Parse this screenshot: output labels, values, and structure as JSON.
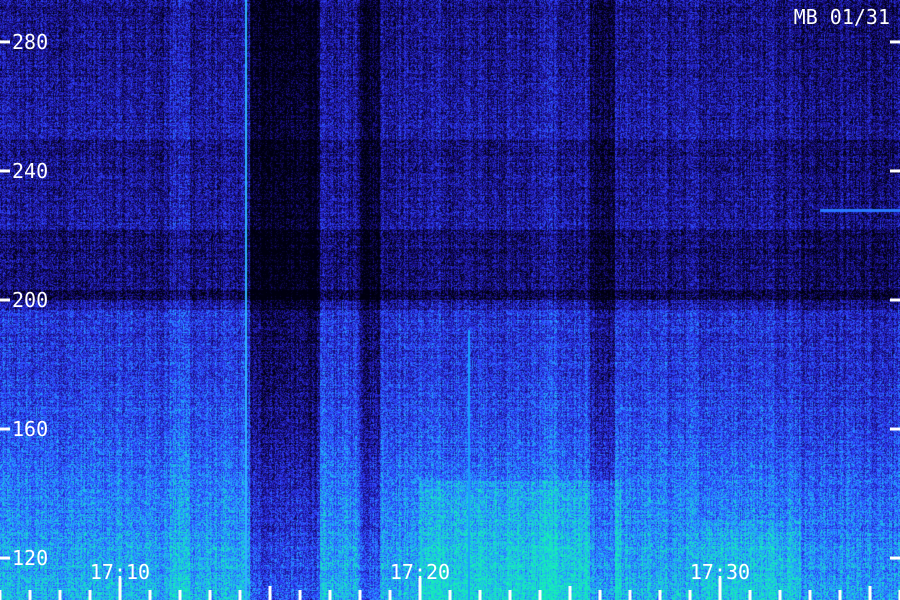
{
  "chart_data": {
    "type": "heatmap",
    "title": "MB 01/31",
    "xlabel": "",
    "ylabel": "",
    "y_ticks": [
      280,
      240,
      200,
      160,
      120
    ],
    "ylim": [
      107,
      293
    ],
    "x_tick_labels": [
      "17:10",
      "17:20",
      "17:30"
    ],
    "x_major_ticks_minutes": [
      10,
      20,
      30
    ],
    "xlim_minutes": [
      6,
      36
    ],
    "grid": false,
    "colormap": [
      "#000010",
      "#1a0f8c",
      "#2f3fff",
      "#25a6ff",
      "#14f0b4"
    ],
    "background_color": "#02001a"
  }
}
